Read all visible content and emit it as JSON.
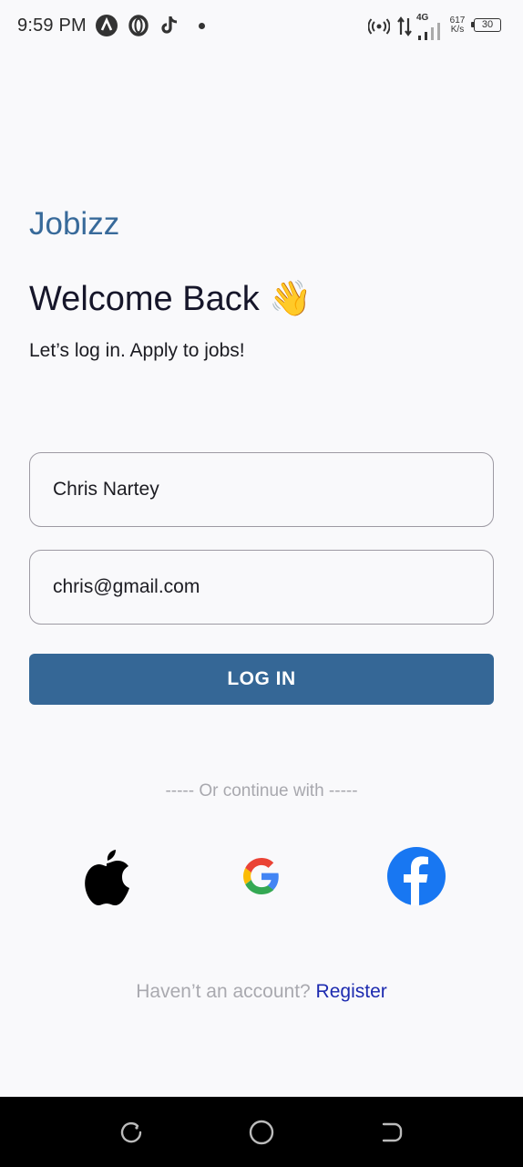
{
  "status_bar": {
    "time": "9:59 PM",
    "icons": [
      "app-a-icon",
      "opera-icon",
      "tiktok-icon",
      "notification-dot-icon",
      "hotspot-icon",
      "data-arrows-icon",
      "signal-4g-icon"
    ],
    "network_type": "4G",
    "speed_value": "617",
    "speed_unit": "K/s",
    "battery_level": "30"
  },
  "brand": "Jobizz",
  "title": "Welcome Back 👋",
  "subtitle": "Let’s log in. Apply to jobs!",
  "form": {
    "name_value": "Chris Nartey",
    "email_value": "chris@gmail.com",
    "login_label": "LOG IN"
  },
  "divider": "----- Or continue with -----",
  "social": [
    "apple-icon",
    "google-icon",
    "facebook-icon"
  ],
  "register": {
    "prompt": "Haven’t an account? ",
    "link": "Register"
  },
  "nav": [
    "recents-icon",
    "home-icon",
    "back-icon"
  ],
  "colors": {
    "primary": "#356796",
    "brand_text": "#386a9a",
    "link": "#1d2bb0",
    "facebook": "#1877f2"
  }
}
